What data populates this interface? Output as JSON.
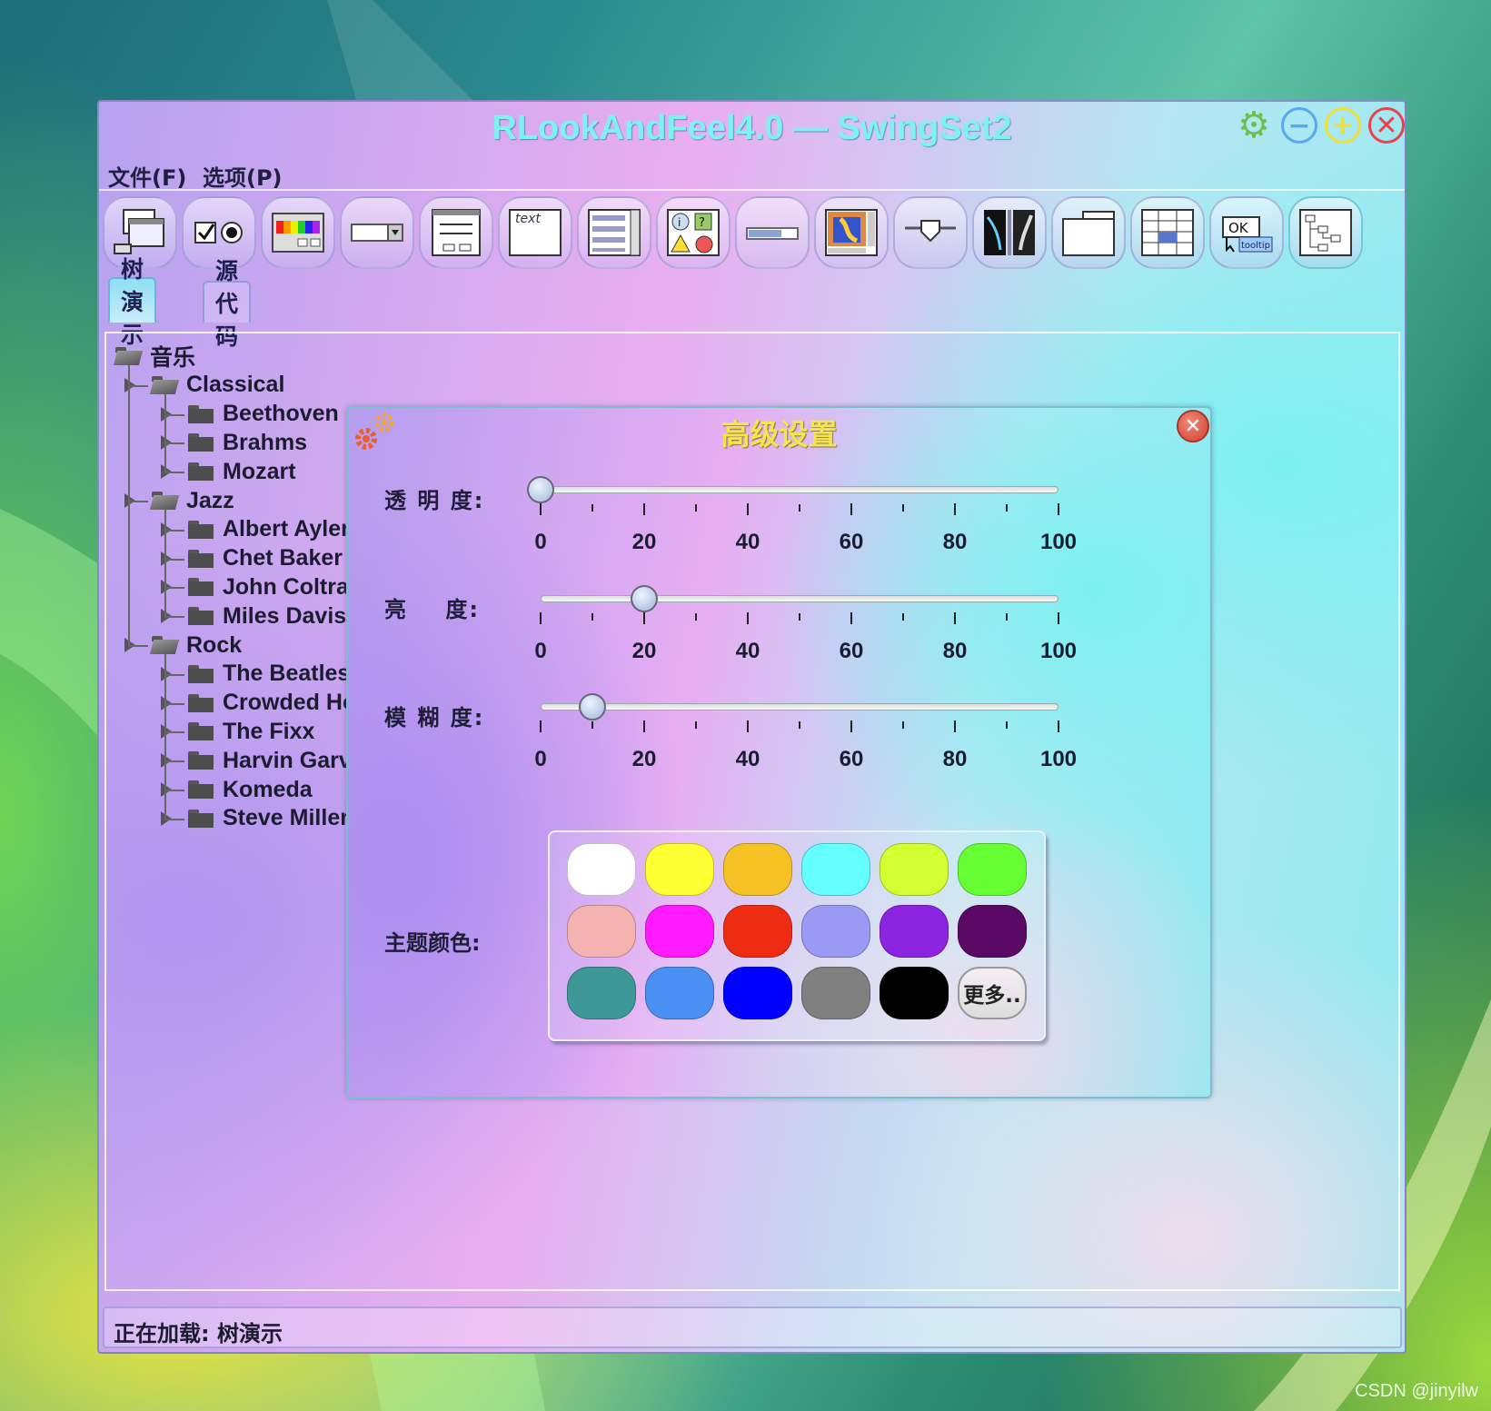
{
  "window": {
    "title": "RLookAndFeel4.0 — SwingSet2"
  },
  "window_controls": {
    "minimize": "−",
    "maximize": "+",
    "close": "✕"
  },
  "menubar": {
    "file": "文件(F)",
    "options": "选项(P)"
  },
  "toolbar": {
    "items": [
      {
        "icon": "internal-frame-icon"
      },
      {
        "icon": "checkbox-radio-icon"
      },
      {
        "icon": "color-chooser-icon"
      },
      {
        "icon": "combobox-icon"
      },
      {
        "icon": "file-chooser-icon"
      },
      {
        "icon": "editor-pane-icon",
        "text": "text"
      },
      {
        "icon": "list-icon"
      },
      {
        "icon": "option-pane-icon"
      },
      {
        "icon": "progress-bar-icon"
      },
      {
        "icon": "scroll-pane-icon"
      },
      {
        "icon": "slider-icon"
      },
      {
        "icon": "split-pane-icon"
      },
      {
        "icon": "tabbed-pane-icon"
      },
      {
        "icon": "table-icon"
      },
      {
        "icon": "tooltip-icon",
        "text": "OK",
        "subtext": "tooltip"
      },
      {
        "icon": "tree-icon"
      }
    ]
  },
  "tabs": [
    {
      "label": "树演示",
      "selected": true
    },
    {
      "label": "源代码",
      "selected": false
    }
  ],
  "tree": {
    "root": "音乐",
    "nodes": [
      {
        "label": "Classical",
        "level": 1,
        "open": true
      },
      {
        "label": "Beethoven",
        "level": 2
      },
      {
        "label": "Brahms",
        "level": 2
      },
      {
        "label": "Mozart",
        "level": 2
      },
      {
        "label": "Jazz",
        "level": 1,
        "open": true
      },
      {
        "label": "Albert Ayler",
        "level": 2
      },
      {
        "label": "Chet Baker",
        "level": 2
      },
      {
        "label": "John Coltrane",
        "level": 2
      },
      {
        "label": "Miles Davis",
        "level": 2
      },
      {
        "label": "Rock",
        "level": 1,
        "open": true
      },
      {
        "label": "The Beatles",
        "level": 2
      },
      {
        "label": "Crowded House",
        "level": 2
      },
      {
        "label": "The Fixx",
        "level": 2
      },
      {
        "label": "Harvin Garvel",
        "level": 2
      },
      {
        "label": "Komeda",
        "level": 2
      },
      {
        "label": "Steve Miller",
        "level": 2
      }
    ]
  },
  "dialog": {
    "title": "高级设置",
    "close": "✕",
    "sliders": [
      {
        "label": "透 明 度:",
        "value": 0
      },
      {
        "label": "亮    度:",
        "value": 20
      },
      {
        "label": "模 糊 度:",
        "value": 10
      }
    ],
    "tick_labels": [
      "0",
      "20",
      "40",
      "60",
      "80",
      "100"
    ],
    "theme_label": "主题颜色:",
    "theme_colors": [
      "#ffffff",
      "#ffff33",
      "#f5c125",
      "#66ffff",
      "#d4ff33",
      "#66ff33",
      "#f4b3b0",
      "#ff1aff",
      "#ee2c12",
      "#9a9af5",
      "#8a24e0",
      "#5a0a64",
      "#3f9898",
      "#4a90f2",
      "#0000ff",
      "#808080",
      "#000000"
    ],
    "more_label": "更多.."
  },
  "statusbar": {
    "text": "正在加载: 树演示"
  },
  "watermark": "CSDN @jinyilw",
  "accent_colors": {
    "title": "#7df2f0",
    "dialog_title": "#f3e64a",
    "tab_selected": "#8fdef5"
  }
}
